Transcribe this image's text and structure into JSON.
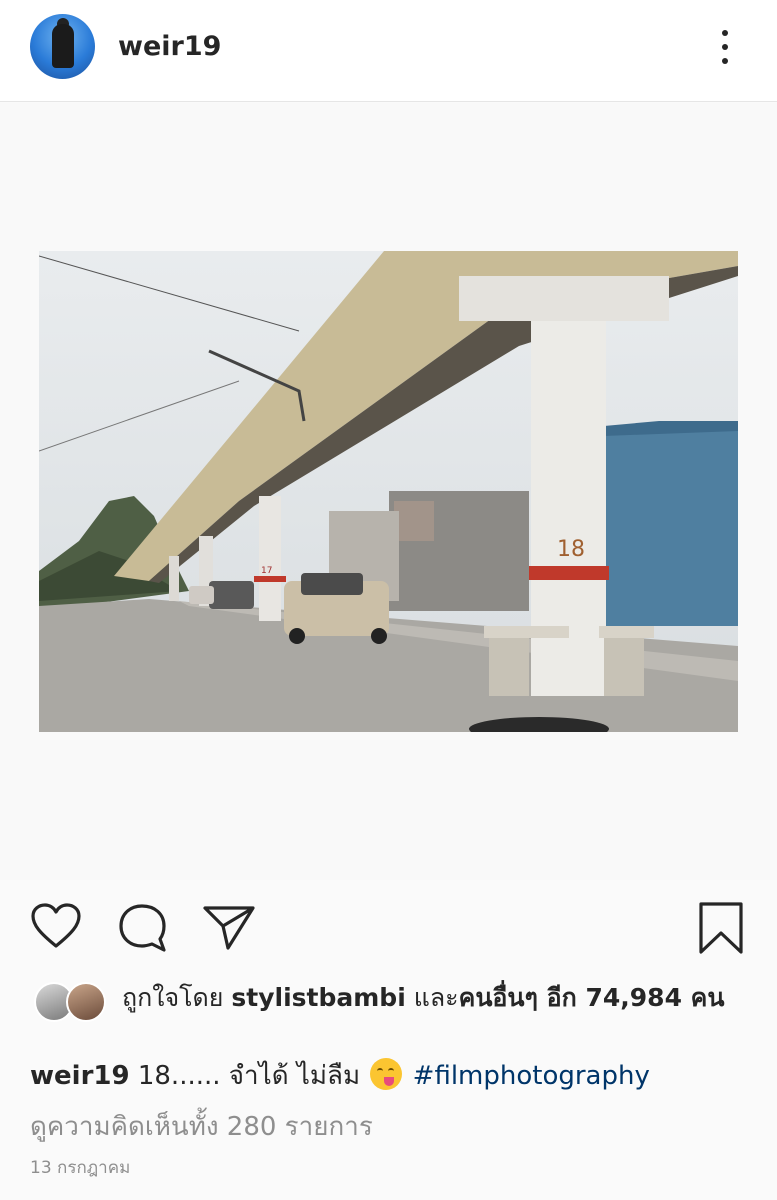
{
  "header": {
    "username": "weir19",
    "more_icon": "more-vertical-icon"
  },
  "post": {
    "photo_description_icon": "photo",
    "pillar_labels": [
      "18",
      "17"
    ]
  },
  "actions": {
    "like_icon": "heart-icon",
    "comment_icon": "comment-icon",
    "share_icon": "send-icon",
    "save_icon": "bookmark-icon"
  },
  "likes": {
    "prefix": "ถูกใจโดย ",
    "user": "stylistbambi",
    "middle": " และ",
    "others": "คนอื่นๆ อีก 74,984 คน"
  },
  "caption": {
    "username": "weir19",
    "text": " 18...... จำได้ ไม่ลืม ",
    "emoji": "yum-emoji",
    "hashtag": "#filmphotography"
  },
  "comments": {
    "label": "ดูความคิดเห็นทั้ง 280 รายการ"
  },
  "date": {
    "label": "13 กรกฎาคม"
  }
}
